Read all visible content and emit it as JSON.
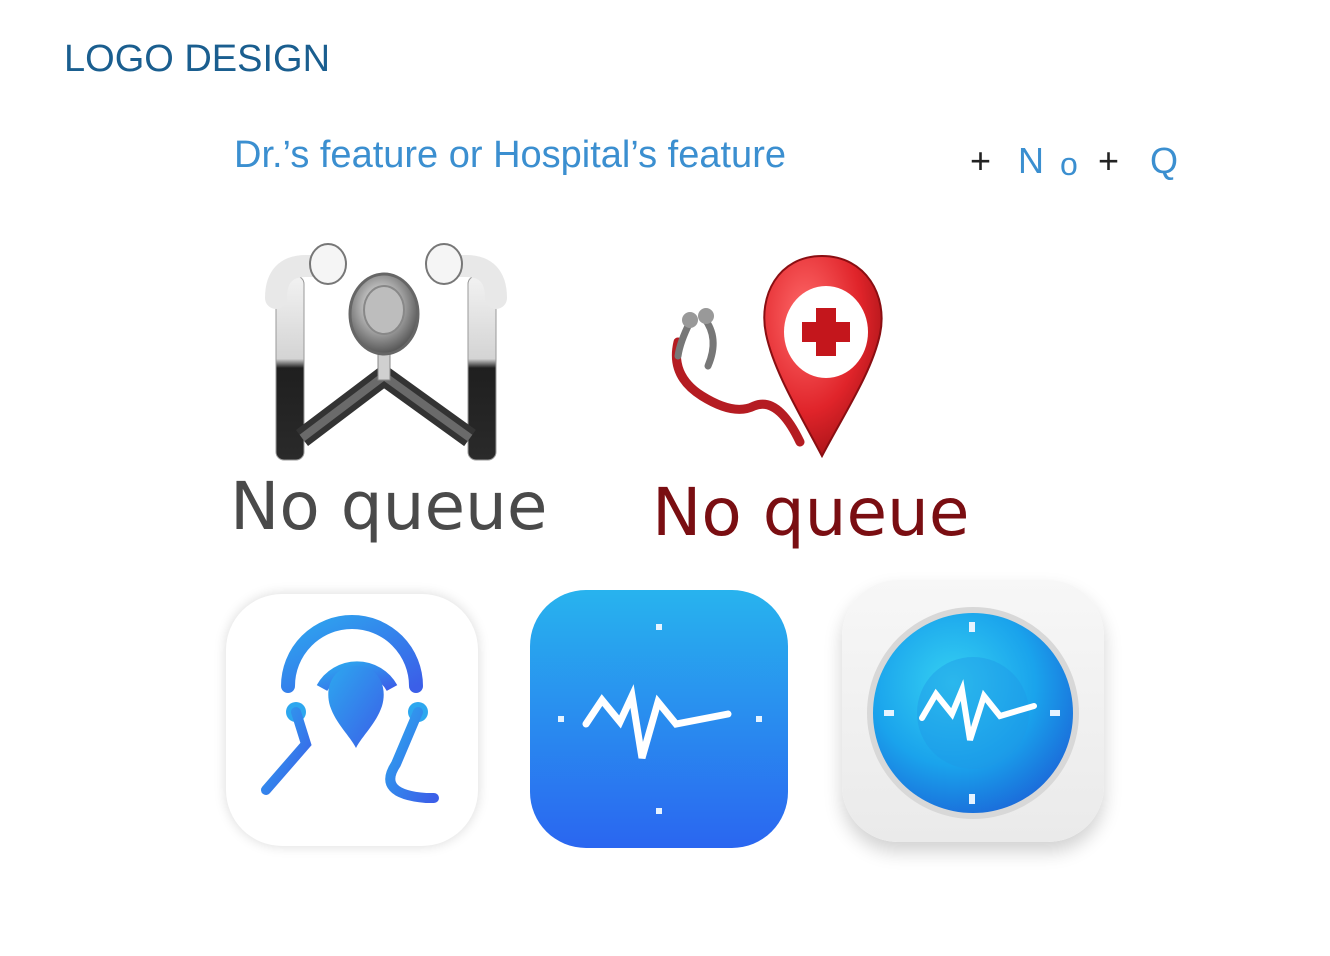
{
  "header": {
    "title": "LOGO DESIGN",
    "subtitle": "Dr.’s feature or Hospital’s feature",
    "formula": {
      "plus1": "+",
      "n": "N",
      "o": "o",
      "plus2": "+",
      "q": "Q"
    }
  },
  "logos": [
    {
      "caption": "No queue",
      "caption_color": "#4a4a4a",
      "icon": "stethoscope-w-icon"
    },
    {
      "caption": "No queue",
      "caption_color": "#7a0e12",
      "icon": "map-pin-stethoscope-icon"
    }
  ],
  "app_icons": [
    {
      "icon": "q-pin-icon",
      "style": "white"
    },
    {
      "icon": "heartbeat-clock-icon",
      "style": "blue-gradient"
    },
    {
      "icon": "heartbeat-clock-round-icon",
      "style": "white-3d"
    }
  ],
  "colors": {
    "title": "#1a5e8f",
    "subtitle": "#3b8fd0",
    "icon_blue_top": "#28b3ee",
    "icon_blue_bottom": "#2a66f0",
    "red": "#e0242a"
  }
}
